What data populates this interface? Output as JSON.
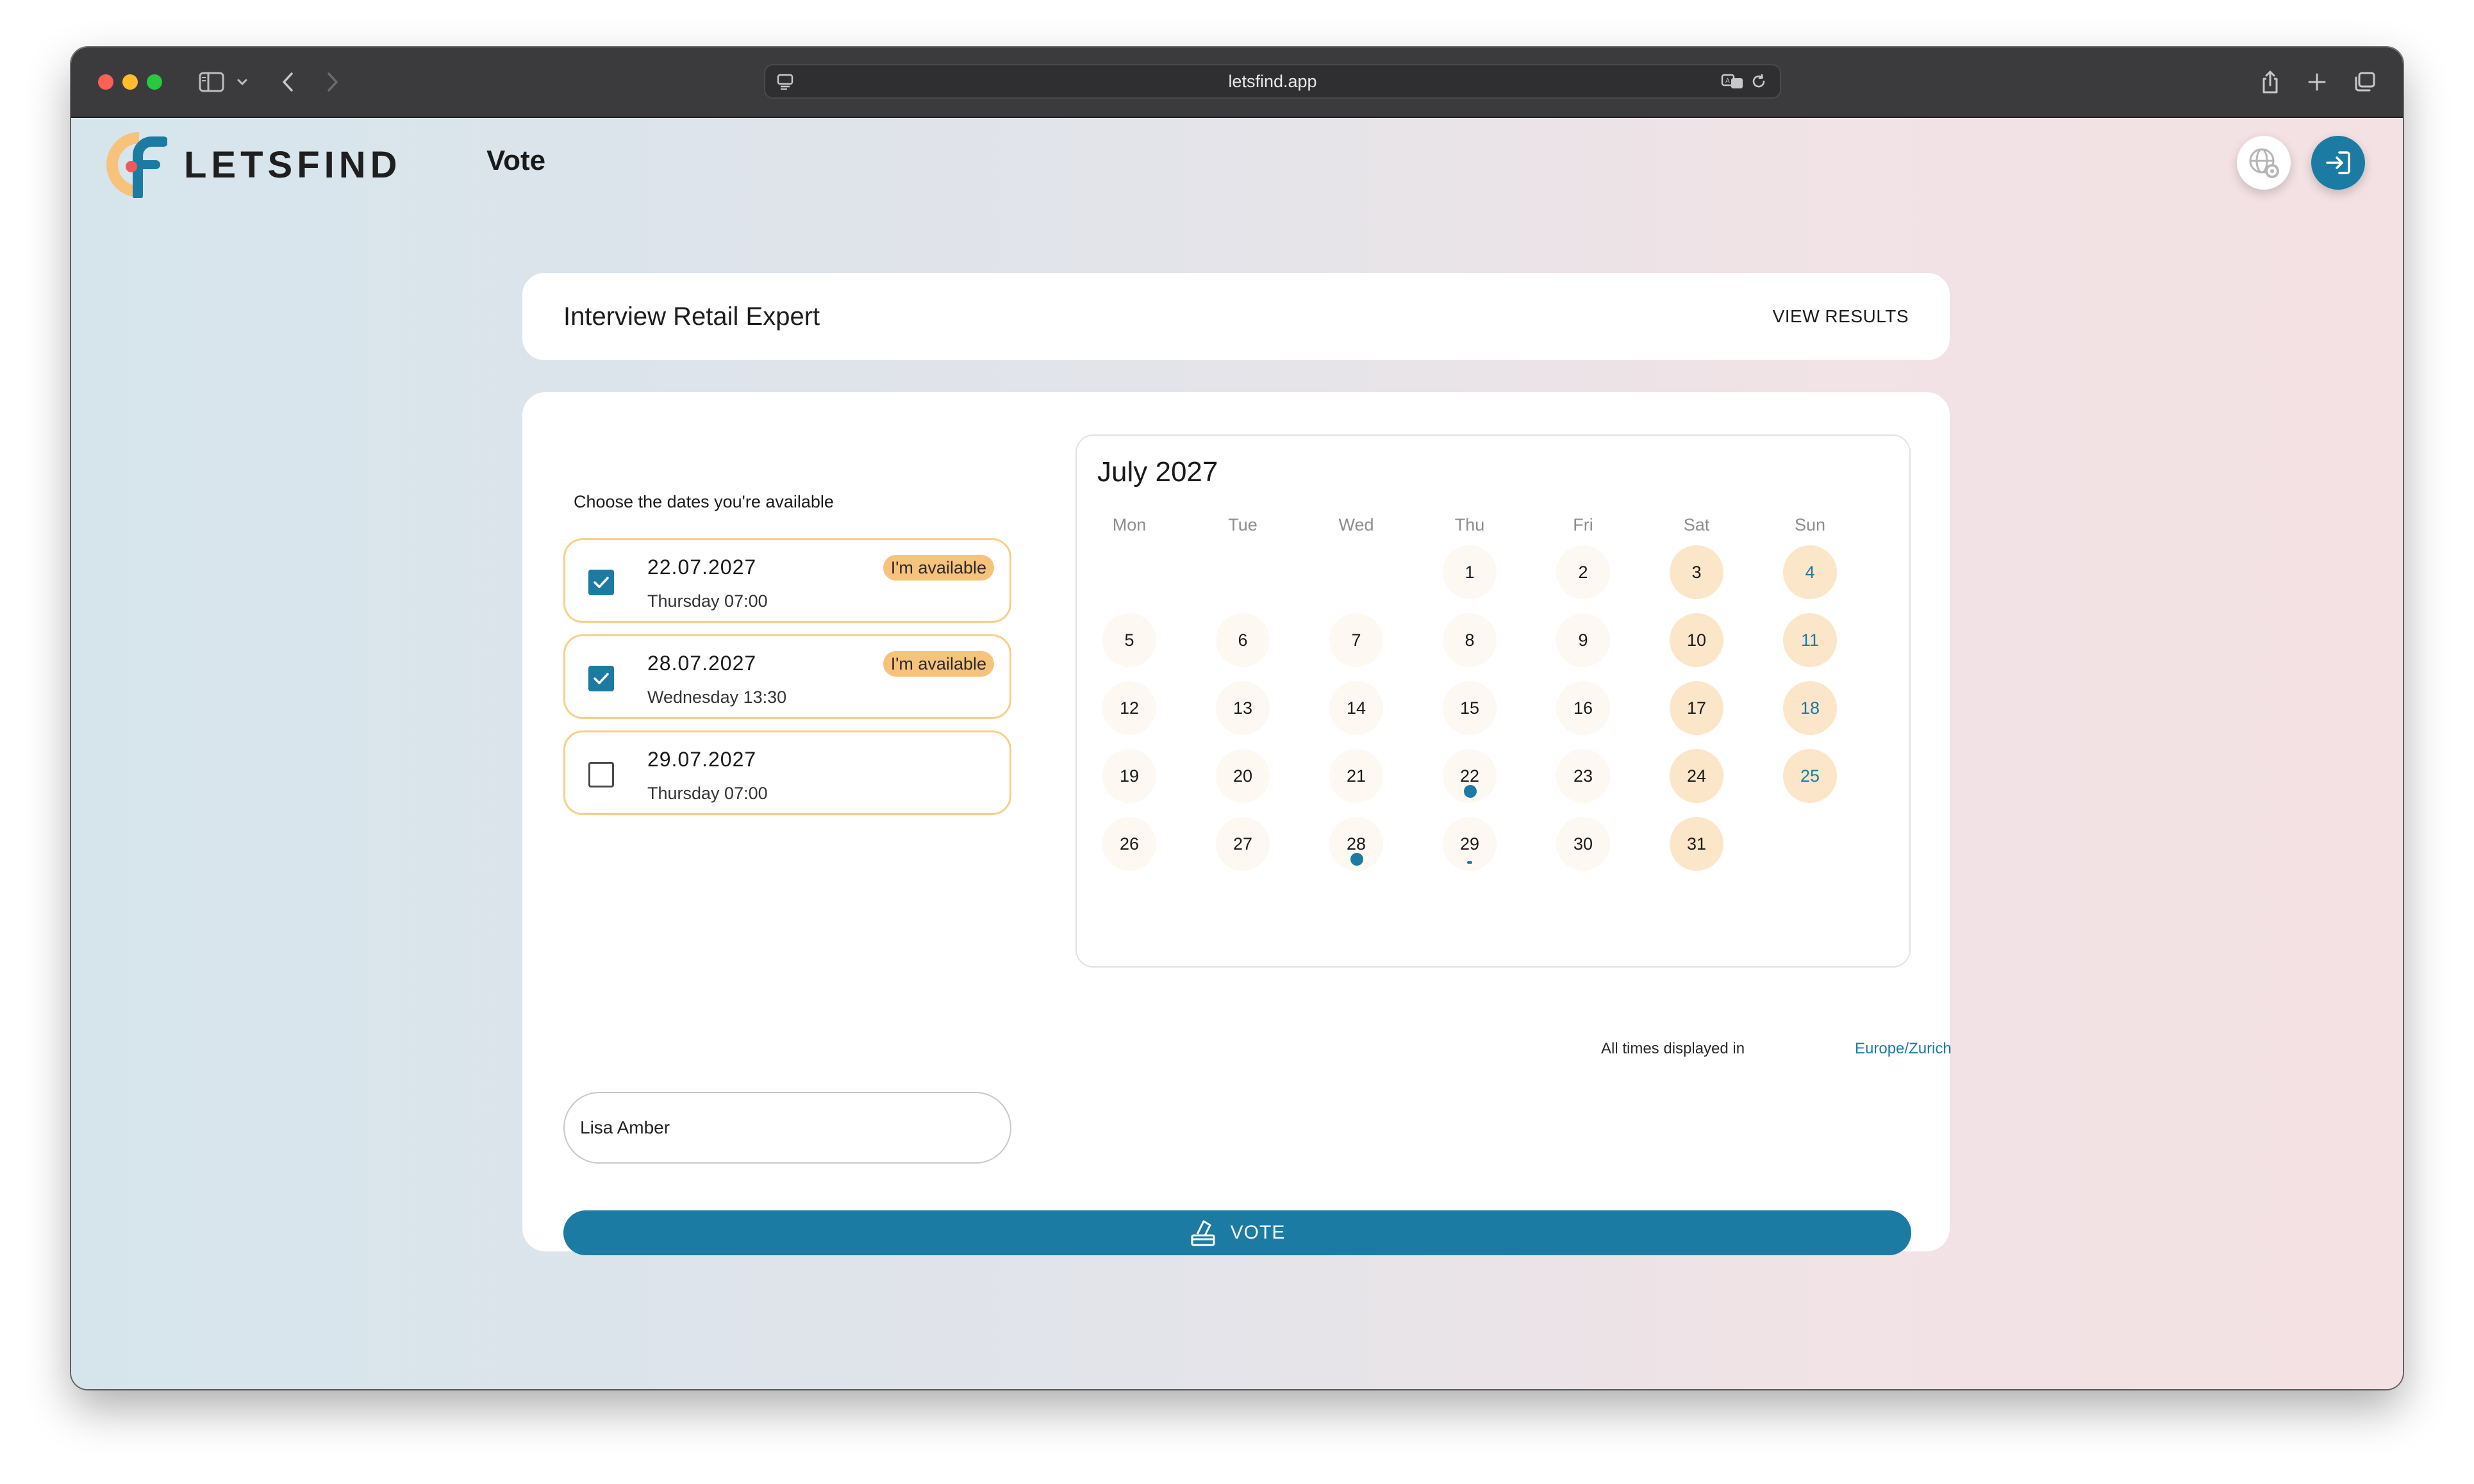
{
  "browser": {
    "url": "letsfind.app"
  },
  "app": {
    "brand_name": "LETSFIND",
    "page_title": "Vote"
  },
  "poll": {
    "title": "Interview Retail Expert",
    "view_results_label": "VIEW RESULTS"
  },
  "availability": {
    "prompt": "Choose the dates you're available",
    "options": [
      {
        "date": "22.07.2027",
        "time": "Thursday 07:00",
        "checked": true,
        "badge": "I'm available"
      },
      {
        "date": "28.07.2027",
        "time": "Wednesday 13:30",
        "checked": true,
        "badge": "I'm available"
      },
      {
        "date": "29.07.2027",
        "time": "Thursday 07:00",
        "checked": false,
        "badge": ""
      }
    ]
  },
  "name_field": {
    "value": "Lisa Amber"
  },
  "vote_button": {
    "label": "VOTE"
  },
  "calendar": {
    "title": "July 2027",
    "weekdays": [
      "Mon",
      "Tue",
      "Wed",
      "Thu",
      "Fri",
      "Sat",
      "Sun"
    ],
    "weeks": [
      [
        "",
        "",
        "",
        "1",
        "2",
        "3",
        "4"
      ],
      [
        "5",
        "6",
        "7",
        "8",
        "9",
        "10",
        "11"
      ],
      [
        "12",
        "13",
        "14",
        "15",
        "16",
        "17",
        "18"
      ],
      [
        "19",
        "20",
        "21",
        "22",
        "23",
        "24",
        "25"
      ],
      [
        "26",
        "27",
        "28",
        "29",
        "30",
        "31",
        ""
      ]
    ],
    "marked_days": [
      "22",
      "28"
    ],
    "faint_marked_days": [
      "29"
    ]
  },
  "timezone": {
    "label": "All times displayed in",
    "value": "Europe/Zurich"
  },
  "colors": {
    "accent": "#1b7ba3",
    "option_border": "#f7cf8c",
    "badge": "#f7c27a",
    "weekend_day": "#fce6c9",
    "weekday_day": "#fdf8f1",
    "titlebar": "#3b3b3d"
  },
  "icons": {
    "window_controls": [
      "close-icon",
      "minimize-icon",
      "zoom-icon"
    ],
    "toolbar_left": [
      "sidebar-icon",
      "chevron-down-icon",
      "back-icon",
      "forward-icon"
    ],
    "url_left": "page-menu-icon",
    "url_right": [
      "translate-icon",
      "reload-icon"
    ],
    "toolbar_right": [
      "share-icon",
      "new-tab-icon",
      "tab-overview-icon"
    ],
    "header": [
      "language-settings-icon",
      "login-icon"
    ],
    "vote": "ballot-box-icon"
  }
}
